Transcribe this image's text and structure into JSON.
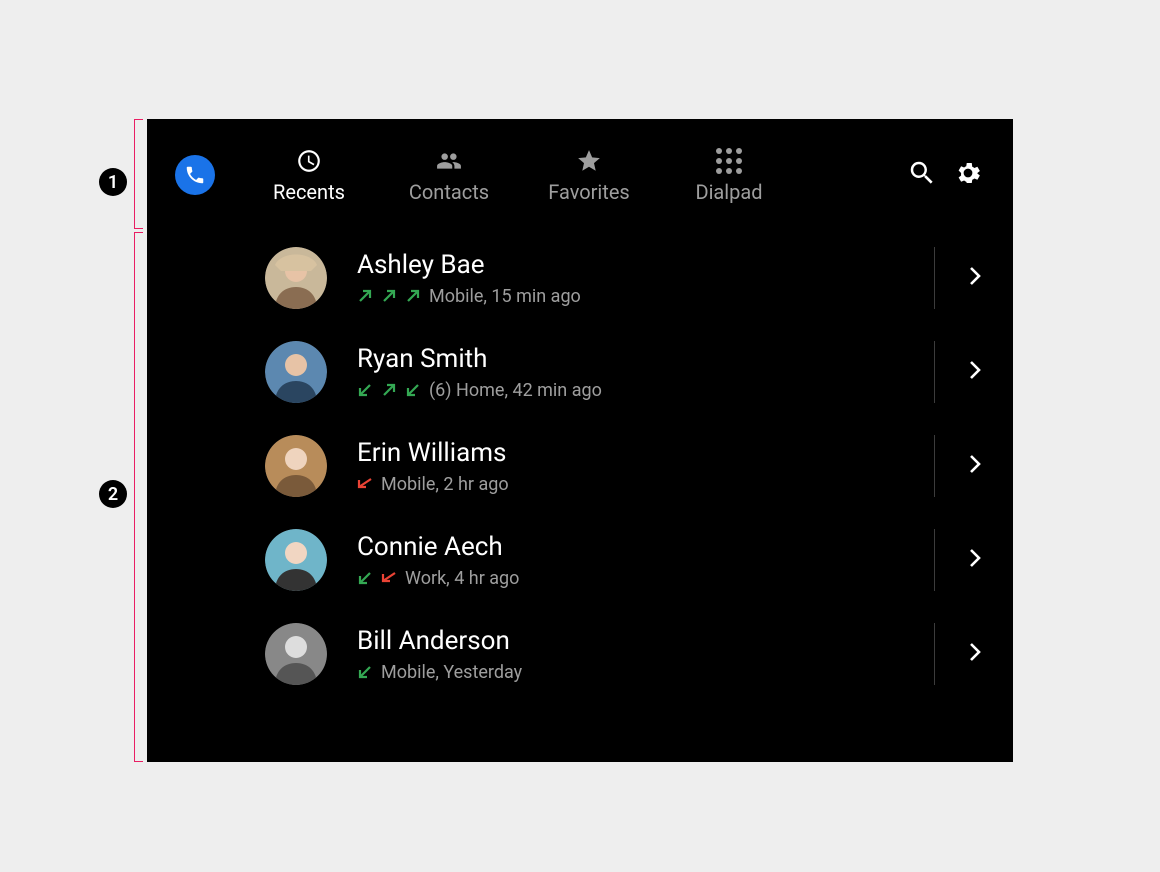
{
  "annotations": {
    "callout1": "1",
    "callout2": "2"
  },
  "tabs": {
    "recents": {
      "label": "Recents",
      "active": true
    },
    "contacts": {
      "label": "Contacts",
      "active": false
    },
    "favorites": {
      "label": "Favorites",
      "active": false
    },
    "dialpad": {
      "label": "Dialpad",
      "active": false
    }
  },
  "calls": [
    {
      "name": "Ashley Bae",
      "directions": [
        "out",
        "out",
        "out"
      ],
      "detail": "Mobile, 15 min ago"
    },
    {
      "name": "Ryan Smith",
      "directions": [
        "in",
        "out",
        "in"
      ],
      "detail": "(6) Home, 42 min ago"
    },
    {
      "name": "Erin Williams",
      "directions": [
        "miss"
      ],
      "detail": "Mobile, 2 hr ago"
    },
    {
      "name": "Connie Aech",
      "directions": [
        "in",
        "miss"
      ],
      "detail": "Work, 4 hr ago"
    },
    {
      "name": "Bill Anderson",
      "directions": [
        "in"
      ],
      "detail": "Mobile, Yesterday"
    }
  ]
}
